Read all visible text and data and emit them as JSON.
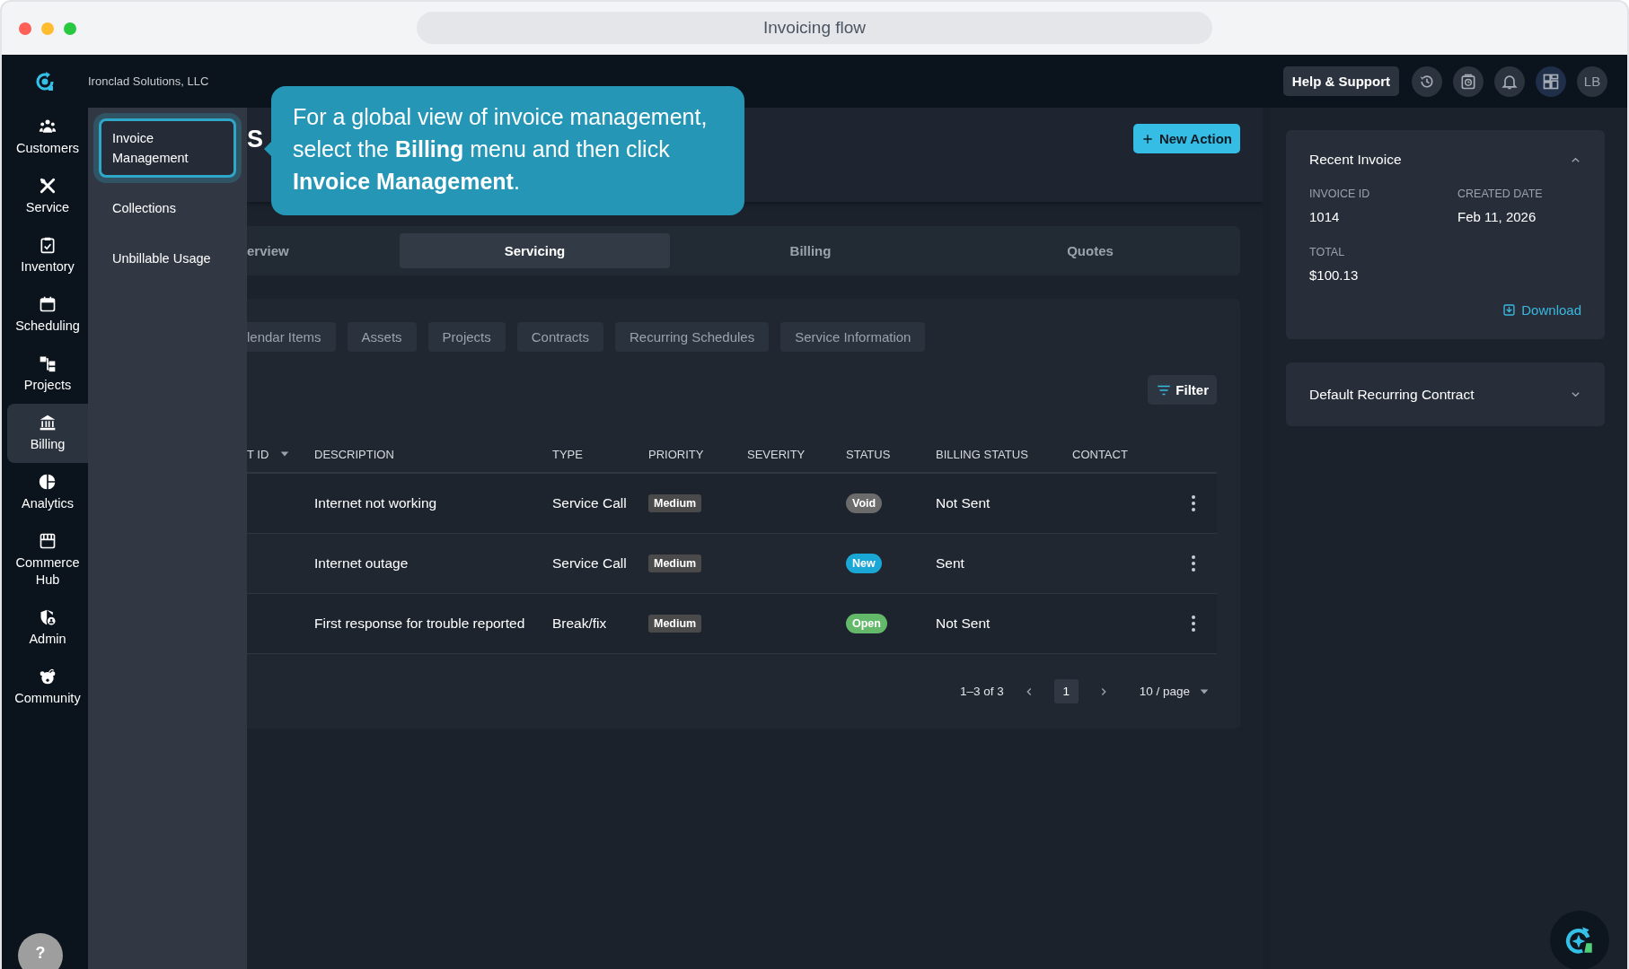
{
  "window": {
    "title": "Invoicing flow"
  },
  "org_name": "Ironclad Solutions, LLC",
  "nav": {
    "items": [
      {
        "label": "Customers",
        "selected": false
      },
      {
        "label": "Service",
        "selected": false
      },
      {
        "label": "Inventory",
        "selected": false
      },
      {
        "label": "Scheduling",
        "selected": false
      },
      {
        "label": "Projects",
        "selected": false
      },
      {
        "label": "Billing",
        "selected": true
      },
      {
        "label": "Analytics",
        "selected": false
      },
      {
        "label": "Commerce Hub",
        "selected": false
      },
      {
        "label": "Admin",
        "selected": false
      },
      {
        "label": "Community",
        "selected": false
      }
    ],
    "help": "?"
  },
  "submenu": {
    "items": [
      {
        "label": "Invoice Management",
        "selected": true
      },
      {
        "label": "Collections",
        "selected": false
      },
      {
        "label": "Unbillable Usage",
        "selected": false
      }
    ]
  },
  "coach_mark": {
    "text": "For a global view of invoice management, select the **Billing** menu and then click **Invoice Management**."
  },
  "top_bar": {
    "help_button": "Help & Support",
    "avatar": "LB"
  },
  "header": {
    "heading": "S",
    "new_action": "New Action"
  },
  "tabs": [
    {
      "label": "erview",
      "selected": false
    },
    {
      "label": "Servicing",
      "selected": true
    },
    {
      "label": "Billing",
      "selected": false
    },
    {
      "label": "Quotes",
      "selected": false
    }
  ],
  "sub_tabs": [
    {
      "label": "lendar Items"
    },
    {
      "label": "Assets"
    },
    {
      "label": "Projects"
    },
    {
      "label": "Contracts"
    },
    {
      "label": "Recurring Schedules"
    },
    {
      "label": "Service Information"
    }
  ],
  "filter": "Filter",
  "table": {
    "columns": [
      "T ID",
      "DESCRIPTION",
      "TYPE",
      "PRIORITY",
      "SEVERITY",
      "STATUS",
      "BILLING STATUS",
      "CONTACT"
    ],
    "rows": [
      {
        "description": "Internet not working",
        "type": "Service Call",
        "priority": "Medium",
        "status": {
          "label": "Void",
          "color": "#6b6b6b"
        },
        "billing_status": "Not Sent"
      },
      {
        "description": "Internet outage",
        "type": "Service Call",
        "priority": "Medium",
        "status": {
          "label": "New",
          "color": "#1aa7d6"
        },
        "billing_status": "Sent"
      },
      {
        "description": "First response for trouble reported",
        "type": "Break/fix",
        "priority": "Medium",
        "status": {
          "label": "Open",
          "color": "#63b86a"
        },
        "billing_status": "Not Sent"
      }
    ]
  },
  "pagination": {
    "summary": "1–3 of 3",
    "page": "1",
    "per_page": "10 / page"
  },
  "recent_invoice": {
    "title": "Recent Invoice",
    "expanded": true,
    "fields": [
      {
        "label": "INVOICE ID",
        "value": "1014"
      },
      {
        "label": "CREATED DATE",
        "value": "Feb 11, 2026"
      },
      {
        "label": "TOTAL",
        "value": "$100.13"
      }
    ],
    "download": "Download"
  },
  "contract_panel": {
    "title": "Default Recurring Contract",
    "expanded": false
  }
}
